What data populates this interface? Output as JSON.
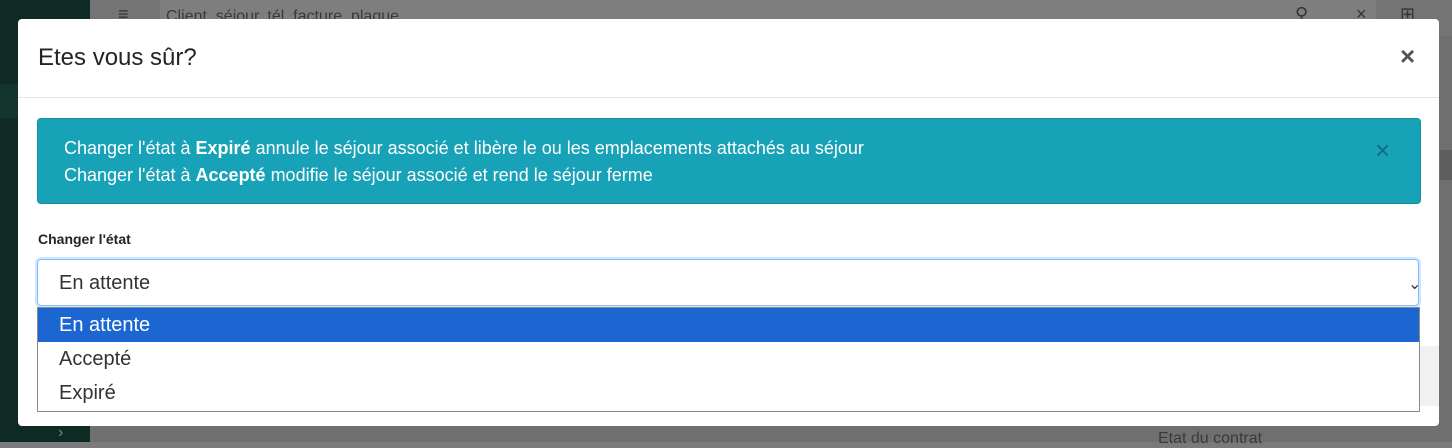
{
  "background": {
    "search_placeholder": "Client, séjour, tél, facture, plaque",
    "bottom_text": "Etat du contrat"
  },
  "modal": {
    "title": "Etes vous sûr?",
    "close_label": "×",
    "alert": {
      "line1_prefix": "Changer l'état à ",
      "line1_bold": "Expiré",
      "line1_suffix": " annule le séjour associé et libère le ou les emplacements attachés au séjour",
      "line2_prefix": "Changer l'état à ",
      "line2_bold": "Accepté",
      "line2_suffix": " modifie le séjour associé et rend le séjour ferme",
      "close_label": "×"
    },
    "field_label": "Changer l'état",
    "select": {
      "value": "En attente",
      "options": [
        "En attente",
        "Accepté",
        "Expiré"
      ],
      "selected_index": 0
    }
  },
  "colors": {
    "alert_bg": "#17a2b8",
    "selected_option_bg": "#1b66d1"
  }
}
